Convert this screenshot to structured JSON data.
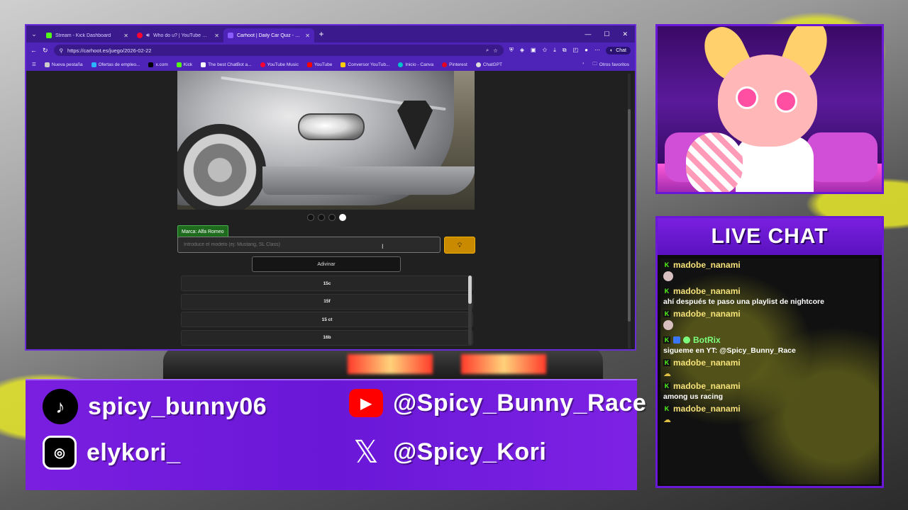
{
  "browser": {
    "tabs": [
      {
        "label": "Stream - Kick Dashboard",
        "icon": "kick-icon",
        "active": false
      },
      {
        "label": "Who do u? | YouTube Music",
        "icon": "youtube-music-icon",
        "active": false
      },
      {
        "label": "Carhoot | Daily Car Quiz - Guess th",
        "icon": "carhoot-icon",
        "active": true
      }
    ],
    "url": "https://carhoot.es/juego/2026-02-22",
    "chat_button": "Chat",
    "bookmarks": [
      {
        "label": "Nueva pestaña",
        "icon": "page-icon"
      },
      {
        "label": "Ofertas de empleo...",
        "icon": "job-icon"
      },
      {
        "label": "x.com",
        "icon": "x-icon"
      },
      {
        "label": "Kick",
        "icon": "kick-icon"
      },
      {
        "label": "The best ChatBot a...",
        "icon": "chatbot-icon"
      },
      {
        "label": "YouTube Music",
        "icon": "youtube-music-icon"
      },
      {
        "label": "YouTube",
        "icon": "youtube-icon"
      },
      {
        "label": "Conversor YouTub...",
        "icon": "converter-icon"
      },
      {
        "label": "Inicio - Canva",
        "icon": "canva-icon"
      },
      {
        "label": "Pinterest",
        "icon": "pinterest-icon"
      },
      {
        "label": "ChatGPT",
        "icon": "chatgpt-icon"
      }
    ],
    "other_favorites": "Otros favoritos"
  },
  "game": {
    "brand_chip": "Marca: Alfa Romeo",
    "model_placeholder": "Introduce el modelo (ej: Mustang, SL Class)",
    "guess_button": "Adivinar",
    "hint_icon": "lightbulb-icon",
    "photo_dots": {
      "count": 4,
      "active_index": 3
    },
    "suggestions": [
      "15c",
      "15f",
      "15 ct",
      "16b"
    ]
  },
  "social": {
    "tiktok": "spicy_bunny06",
    "instagram": "elykori_",
    "youtube": "@Spicy_Bunny_Race",
    "x": "@Spicy_Kori"
  },
  "chat": {
    "title": "LIVE CHAT",
    "messages": [
      {
        "user": "madobe_nanami",
        "text": "",
        "emote": "avatar"
      },
      {
        "user": "madobe_nanami",
        "text": "ahí después te paso una playlist de nightcore",
        "emote": ""
      },
      {
        "user": "madobe_nanami",
        "text": "",
        "emote": "avatar"
      },
      {
        "user": "BotRix",
        "text": "sigueme en YT: @Spicy_Bunny_Race",
        "emote": "",
        "bot": true
      },
      {
        "user": "madobe_nanami",
        "text": "",
        "emote": "emote"
      },
      {
        "user": "madobe_nanami",
        "text": "among us racing",
        "emote": ""
      },
      {
        "user": "madobe_nanami",
        "text": "",
        "emote": "emote"
      }
    ]
  },
  "colors": {
    "accent": "#6a17d8",
    "kick_green": "#53fc18",
    "username": "#f7e37a",
    "bot_name": "#7dff7d",
    "hint_button": "#c98a00"
  }
}
